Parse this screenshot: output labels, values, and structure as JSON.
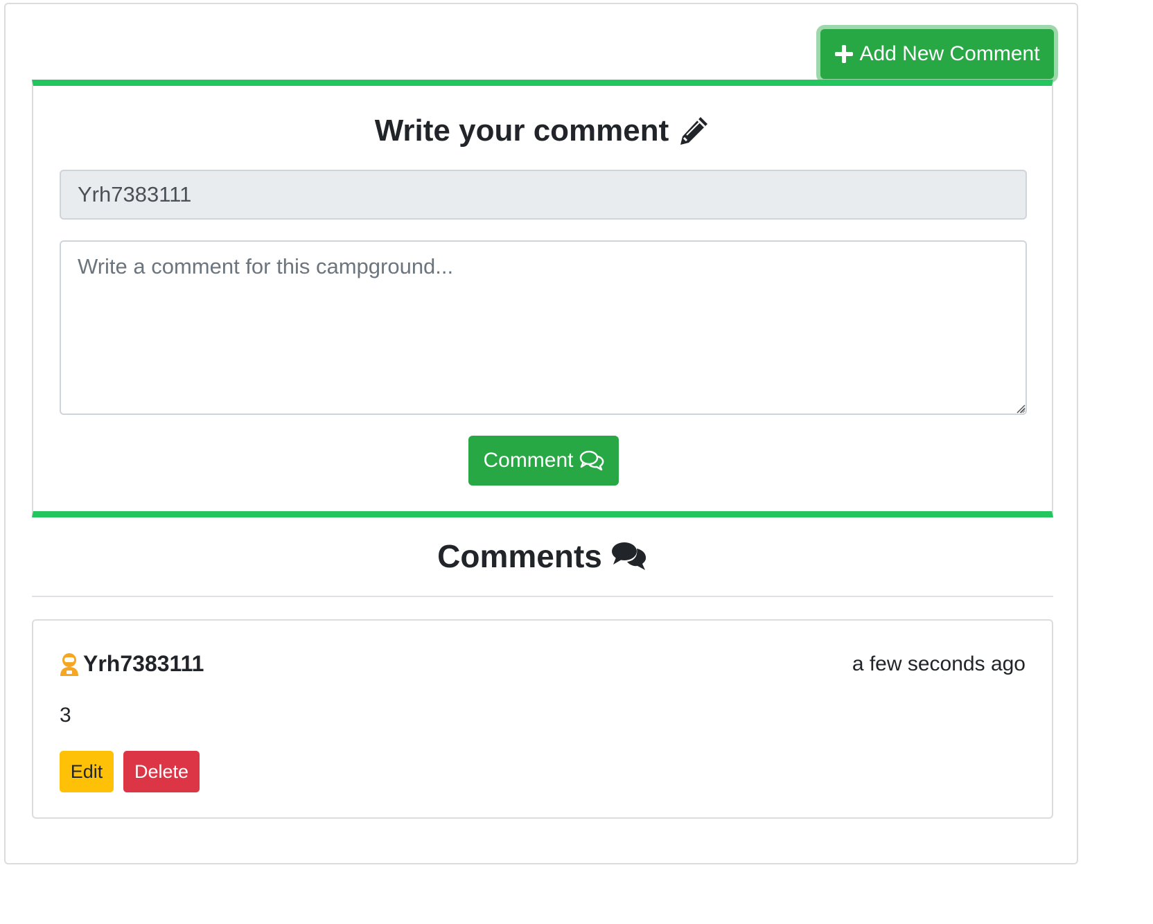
{
  "add_button": {
    "label": "Add New Comment",
    "icon": "plus-icon"
  },
  "write_form": {
    "title": "Write your comment",
    "title_icon": "pencil-icon",
    "username_value": "Yrh7383111",
    "comment_placeholder": "Write a comment for this campground...",
    "submit_label": "Comment",
    "submit_icon": "chat-bubbles-outline-icon"
  },
  "comments_section": {
    "heading": "Comments",
    "heading_icon": "comments-icon",
    "items": [
      {
        "author": "Yrh7383111",
        "author_icon": "user-astronaut-icon",
        "time": "a few seconds ago",
        "text": "3",
        "edit_label": "Edit",
        "delete_label": "Delete"
      }
    ]
  },
  "colors": {
    "accent_green": "#28a745",
    "card_border_green": "#22c55e",
    "edit_yellow": "#ffc107",
    "delete_red": "#dc3545",
    "user_icon_orange": "#f5a623"
  }
}
